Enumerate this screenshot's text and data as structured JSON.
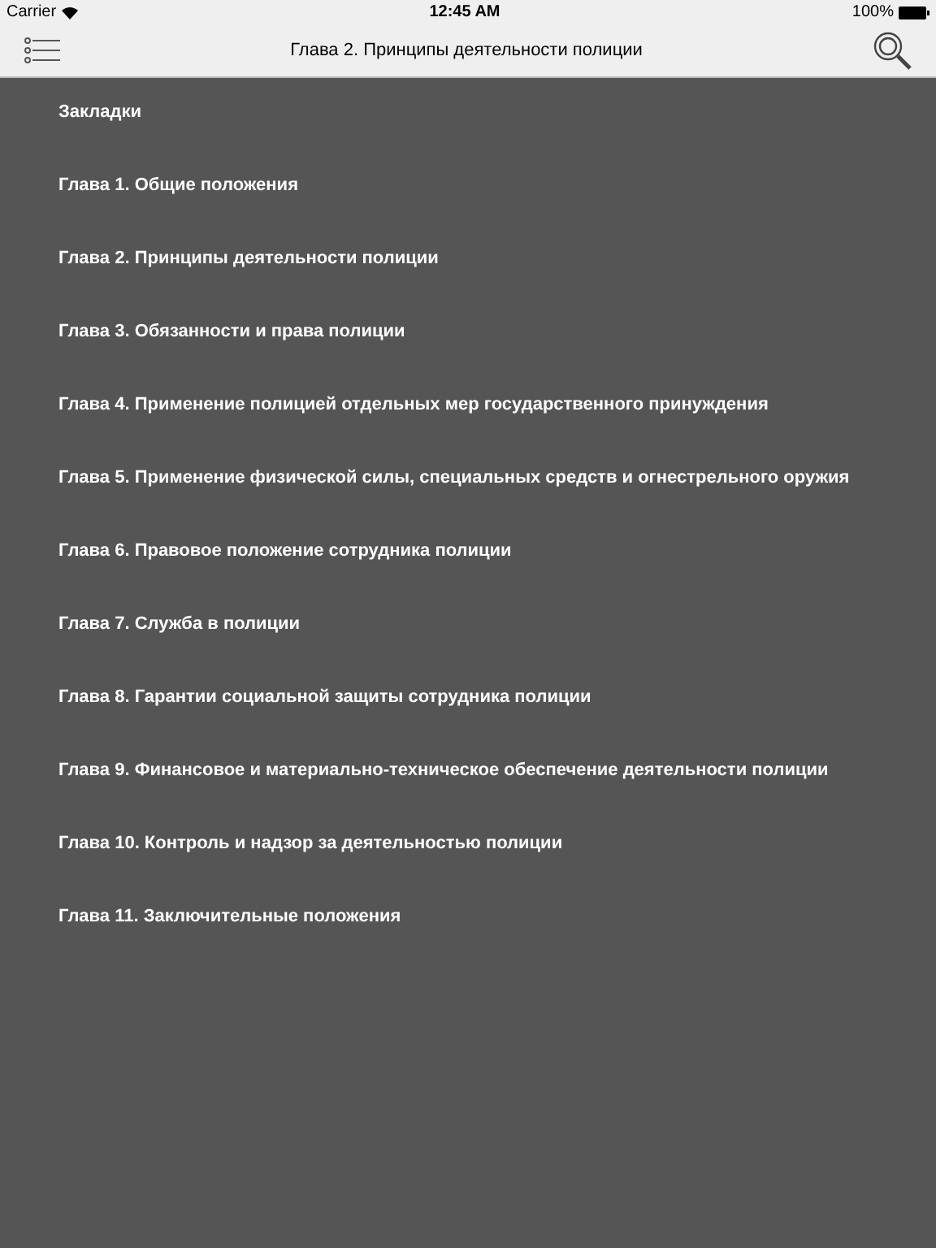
{
  "status_bar": {
    "carrier": "Carrier",
    "time": "12:45 AM",
    "battery": "100%"
  },
  "nav_bar": {
    "title": "Глава 2. Принципы деятельности полиции"
  },
  "menu": {
    "items": [
      {
        "label": "Закладки"
      },
      {
        "label": "Глава 1. Общие положения"
      },
      {
        "label": "Глава 2. Принципы деятельности полиции"
      },
      {
        "label": "Глава 3. Обязанности и права полиции"
      },
      {
        "label": "Глава 4. Применение полицией отдельных мер государственного принуждения"
      },
      {
        "label": "Глава 5. Применение физической силы, специальных средств и огнестрельного оружия"
      },
      {
        "label": "Глава 6. Правовое положение сотрудника полиции"
      },
      {
        "label": "Глава 7. Служба в полиции"
      },
      {
        "label": "Глава 8. Гарантии социальной защиты сотрудника полиции"
      },
      {
        "label": "Глава 9. Финансовое и материально-техническое обеспечение деятельности полиции"
      },
      {
        "label": "Глава 10. Контроль и надзор за деятельностью полиции"
      },
      {
        "label": "Глава 11. Заключительные положения"
      }
    ]
  }
}
